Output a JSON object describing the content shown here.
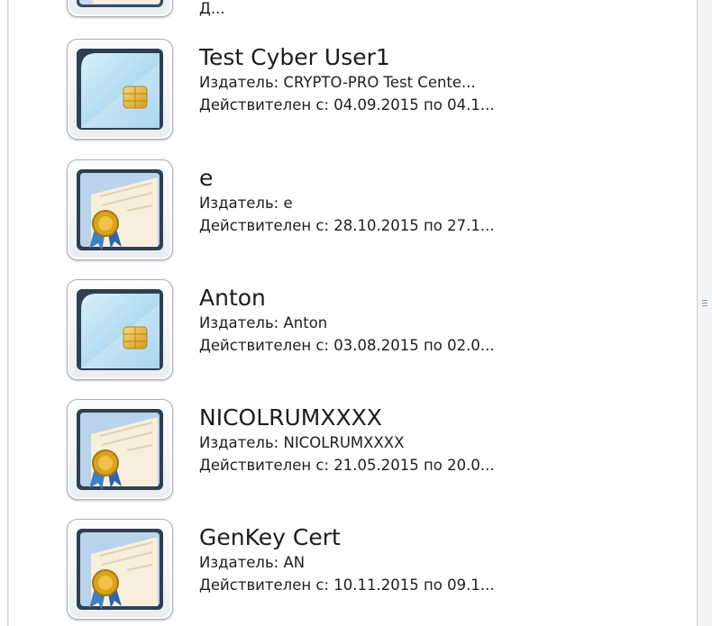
{
  "items": [
    {
      "name": "",
      "issuer": "",
      "validity": "Д...",
      "icon": "certificate-icon"
    },
    {
      "name": "Test Cyber User1",
      "issuer": "Издатель: CRYPTO-PRO Test Cente...",
      "validity": "Действителен с: 04.09.2015 по 04.1...",
      "icon": "smart-card-icon"
    },
    {
      "name": "e",
      "issuer": "Издатель: e",
      "validity": "Действителен с: 28.10.2015 по 27.1...",
      "icon": "certificate-icon"
    },
    {
      "name": "Anton",
      "issuer": "Издатель: Anton",
      "validity": "Действителен с: 03.08.2015 по 02.0...",
      "icon": "smart-card-icon"
    },
    {
      "name": "NICOLRUMXXXX",
      "issuer": "Издатель: NICOLRUMXXXX",
      "validity": "Действителен с: 21.05.2015 по 20.0...",
      "icon": "certificate-icon"
    },
    {
      "name": "GenKey Cert",
      "issuer": "Издатель: AN",
      "validity": "Действителен с: 10.11.2015 по 09.1...",
      "icon": "certificate-icon"
    }
  ],
  "colors": {
    "card_blue": "#8cc9e8",
    "chip_gold": "#e6b43c",
    "seal_gold": "#d9a21b",
    "ribbon_blue": "#3f7fc4",
    "paper": "#f7eedc"
  }
}
